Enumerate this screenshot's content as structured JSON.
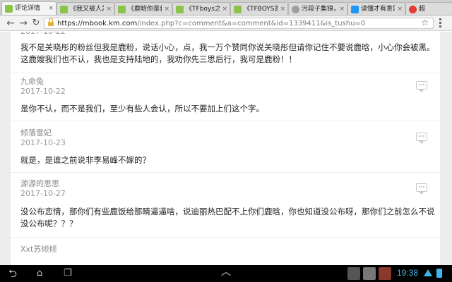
{
  "browser": {
    "tabs": [
      {
        "title": "评论详情",
        "active": true,
        "favicon_color": "#8bc34a"
      },
      {
        "title": "《我又被人发",
        "active": false,
        "favicon_color": "#8bc34a"
      },
      {
        "title": "《鹿晗你是我的",
        "active": false,
        "favicon_color": "#8bc34a"
      },
      {
        "title": "《TFboys之狂",
        "active": false,
        "favicon_color": "#8bc34a"
      },
      {
        "title": "《TFBOYS家有",
        "active": false,
        "favicon_color": "#8bc34a"
      },
      {
        "title": "污段子集锦，肉",
        "active": false,
        "favicon_color": "#9e9e9e"
      },
      {
        "title": "读懂才有意思",
        "active": false,
        "favicon_color": "#2196f3"
      },
      {
        "title": "超",
        "active": false,
        "favicon_color": "#e53935"
      }
    ],
    "url_host": "https://mbook.km.com",
    "url_path": "/index.php?c=comment&a=comment&id=1339411&is_tushu=0"
  },
  "comments": [
    {
      "author": "",
      "date": "2017-10-22",
      "text": "我不是关晓彤的粉丝但我是鹿粉，说话小心，点，我一万个赞同你说关晓彤但请你记住不要说鹿晗，小心你会被黑。这鹿嫂我们也不认，我也是支持陆地的，我劝你先三思后行，我可是鹿粉！！"
    },
    {
      "author": "九命兔",
      "date": "2017-10-22",
      "text": "是你不认，而不是我们，至少有些人会认，所以不要加上们这个字。"
    },
    {
      "author": "倾落雪妃",
      "date": "2017-10-23",
      "text": "就是，是谁之前说非李易峰不嫁的？"
    },
    {
      "author": "源源的思思",
      "date": "2017-10-27",
      "text": "没公布恋情，那你们有些鹿饭给那睛逼逼啥，说迪丽热巴配不上你们鹿晗，你也知道没公布呀，那你们之前怎么不说没公布呢？？？"
    },
    {
      "author": "Xxt苏倾倾",
      "date": "",
      "text": ""
    }
  ],
  "system": {
    "time": "19:38",
    "accent": "#3fb5e8"
  }
}
